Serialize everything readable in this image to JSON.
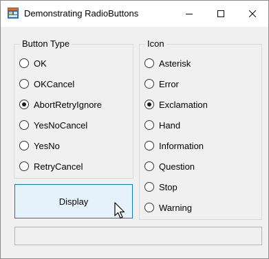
{
  "window": {
    "title": "Demonstrating RadioButtons",
    "app_icon": "winforms-app-icon",
    "controls": {
      "minimize": "minimize-icon",
      "maximize": "maximize-icon",
      "close": "close-icon"
    }
  },
  "button_type_group": {
    "title": "Button Type",
    "options": [
      {
        "label": "OK",
        "checked": false
      },
      {
        "label": "OKCancel",
        "checked": false
      },
      {
        "label": "AbortRetryIgnore",
        "checked": true
      },
      {
        "label": "YesNoCancel",
        "checked": false
      },
      {
        "label": "YesNo",
        "checked": false
      },
      {
        "label": "RetryCancel",
        "checked": false
      }
    ]
  },
  "icon_group": {
    "title": "Icon",
    "options": [
      {
        "label": "Asterisk",
        "checked": false
      },
      {
        "label": "Error",
        "checked": false
      },
      {
        "label": "Exclamation",
        "checked": true
      },
      {
        "label": "Hand",
        "checked": false
      },
      {
        "label": "Information",
        "checked": false
      },
      {
        "label": "Question",
        "checked": false
      },
      {
        "label": "Stop",
        "checked": false
      },
      {
        "label": "Warning",
        "checked": false
      }
    ]
  },
  "display_button": {
    "label": "Display"
  },
  "output_box": {
    "value": ""
  },
  "colors": {
    "button_border": "#0078d7",
    "button_fill": "#e5f1fb",
    "client_bg": "#f0f0f0"
  }
}
